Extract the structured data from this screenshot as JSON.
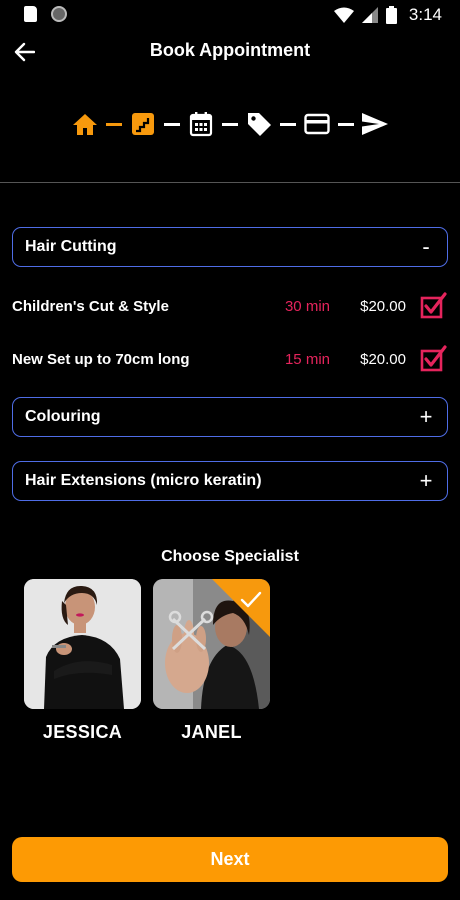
{
  "status_bar": {
    "time": "3:14"
  },
  "header": {
    "title": "Book Appointment"
  },
  "steps": [
    {
      "icon": "home-icon",
      "state": "active"
    },
    {
      "icon": "stairs-icon",
      "state": "active"
    },
    {
      "icon": "calendar-icon",
      "state": "pending"
    },
    {
      "icon": "tag-icon",
      "state": "pending"
    },
    {
      "icon": "credit-card-icon",
      "state": "pending"
    },
    {
      "icon": "send-icon",
      "state": "pending"
    }
  ],
  "categories": [
    {
      "label": "Hair Cutting",
      "toggle": "-",
      "expanded": true,
      "services": [
        {
          "name": "Children's Cut & Style",
          "duration": "30 min",
          "price": "$20.00",
          "checked": true
        },
        {
          "name": "New Set up to 70cm long",
          "duration": "15 min",
          "price": "$20.00",
          "checked": true
        }
      ]
    },
    {
      "label": "Colouring",
      "toggle": "+",
      "expanded": false
    },
    {
      "label": "Hair Extensions (micro keratin)",
      "toggle": "+",
      "expanded": false
    }
  ],
  "specialists": {
    "title": "Choose Specialist",
    "items": [
      {
        "name": "JESSICA",
        "selected": false
      },
      {
        "name": "JANEL",
        "selected": true
      }
    ]
  },
  "colors": {
    "accent": "#fd9a04",
    "duration": "#e5245c",
    "border": "#4f6de6",
    "check": "#e5245c"
  },
  "next_button": {
    "label": "Next"
  }
}
